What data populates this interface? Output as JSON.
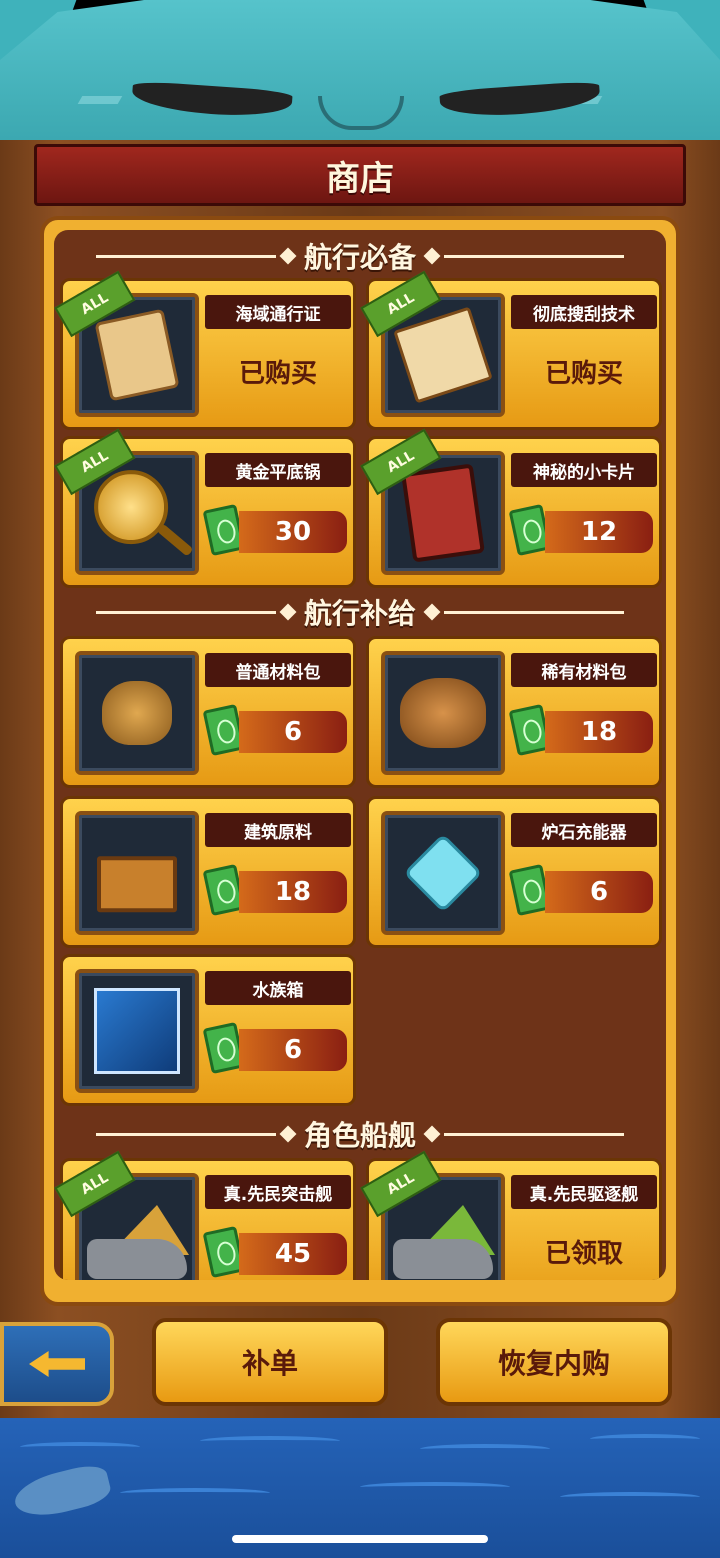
{
  "header": {
    "title": "商店"
  },
  "sections": [
    {
      "title": "航行必备"
    },
    {
      "title": "航行补给"
    },
    {
      "title": "角色船舰"
    }
  ],
  "items": [
    {
      "name": "海域通行证",
      "badge": "ALL",
      "status": "已购买",
      "icon": "map-icon"
    },
    {
      "name": "彻底搜刮技术",
      "badge": "ALL",
      "status": "已购买",
      "icon": "scroll-icon"
    },
    {
      "name": "黄金平底锅",
      "badge": "ALL",
      "price": "30",
      "icon": "pan-icon"
    },
    {
      "name": "神秘的小卡片",
      "badge": "ALL",
      "price": "12",
      "icon": "card-icon"
    },
    {
      "name": "普通材料包",
      "price": "6",
      "icon": "bag-icon"
    },
    {
      "name": "稀有材料包",
      "price": "18",
      "icon": "rare-bag-icon"
    },
    {
      "name": "建筑原料",
      "price": "18",
      "icon": "crate-icon"
    },
    {
      "name": "炉石充能器",
      "price": "6",
      "icon": "crystal-icon"
    },
    {
      "name": "水族箱",
      "price": "6",
      "icon": "aquarium-icon"
    },
    {
      "name": "真.先民突击舰",
      "badge": "ALL",
      "price": "45",
      "icon": "ship-icon"
    },
    {
      "name": "真.先民驱逐舰",
      "badge": "ALL",
      "status": "已领取",
      "icon": "ship-icon"
    }
  ],
  "buttons": {
    "restore_order": "补单",
    "restore_purchase": "恢复内购"
  },
  "colors": {
    "accent": "#f0b030",
    "panel": "#6e3318",
    "title_bar": "#a0271e",
    "mascot": "#3fb2bb",
    "sea": "#2563b8"
  }
}
